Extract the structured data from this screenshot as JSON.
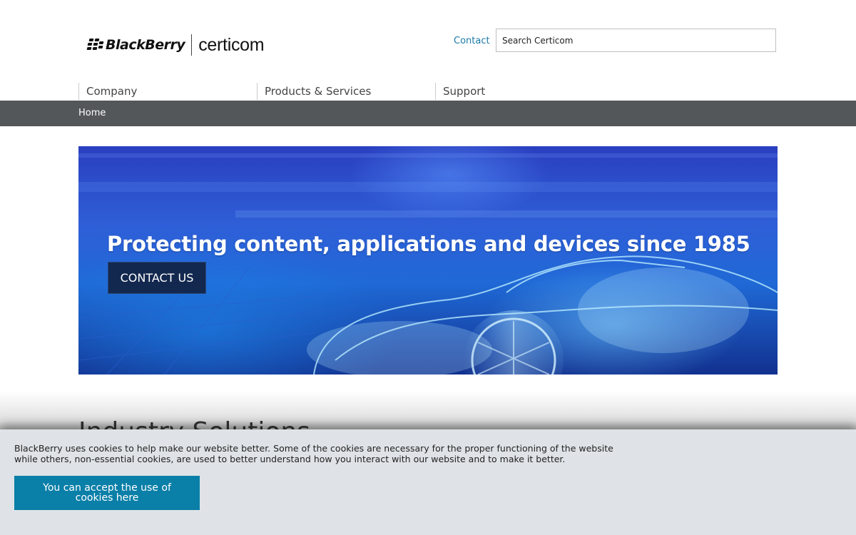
{
  "header": {
    "logo_brand": "BlackBerry",
    "logo_product": "certicom",
    "contact_label": "Contact",
    "search_value": "Search Certicom"
  },
  "nav": {
    "items": [
      {
        "label": "Company"
      },
      {
        "label": "Products & Services"
      },
      {
        "label": "Support"
      }
    ]
  },
  "breadcrumb": {
    "items": [
      {
        "label": "Home"
      }
    ]
  },
  "hero": {
    "title": "Protecting content, applications and devices since 1985",
    "button_label": "CONTACT US"
  },
  "section": {
    "heading": "Industry Solutions"
  },
  "cookie_banner": {
    "text": "BlackBerry uses cookies to help make our website better. Some of the cookies are necessary for the proper functioning of the website while others, non-essential cookies, are used to better understand how you interact with our website and to make it better.",
    "button_label": "You can accept the use of cookies here"
  },
  "colors": {
    "link": "#1a7ba6",
    "breadcrumb_bar": "#53575a",
    "hero_button": "#13284f",
    "cookie_banner_bg": "#dfe3e7",
    "cookie_button": "#0a7fa8"
  },
  "icons": [
    "blackberry-logo-icon"
  ]
}
